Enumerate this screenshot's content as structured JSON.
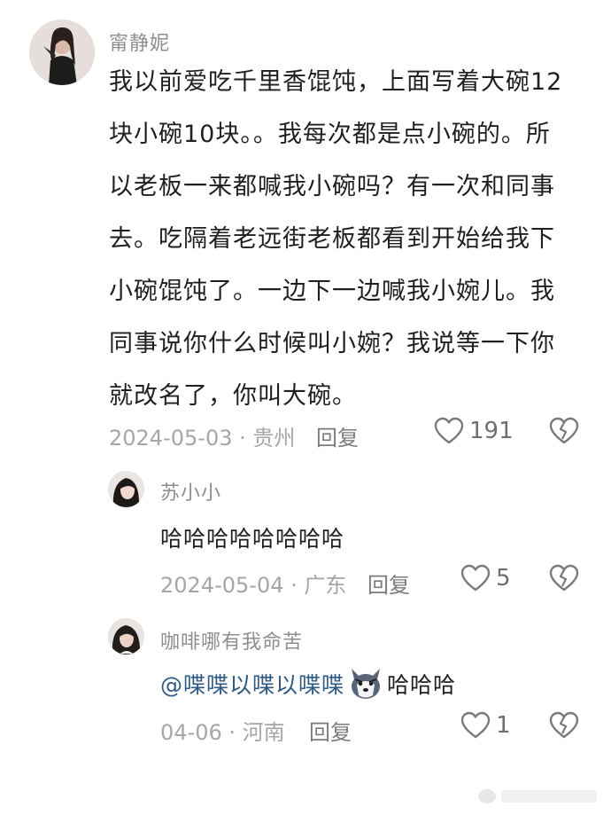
{
  "comments": [
    {
      "username": "甯静妮",
      "text_lines": [
        "我以前爱吃千里香馄饨，上面写着大碗12",
        "块小碗10块。。我每次都是点小碗的。所",
        "以老板一来都喊我小碗吗？有一次和同事",
        "去。吃隔着老远街老板都看到开始给我下",
        "小碗馄饨了。一边下一边喊我小婉儿。我",
        "同事说你什么时候叫小婉？我说等一下你",
        "就改名了，你叫大碗。"
      ],
      "meta": "2024-05-03 · 贵州",
      "reply_label": "回复",
      "likes": "191"
    }
  ],
  "replies": [
    {
      "username": "苏小小",
      "text": "哈哈哈哈哈哈哈哈",
      "meta": "2024-05-04 · 广东",
      "reply_label": "回复",
      "likes": "5"
    },
    {
      "username": "咖啡哪有我命苦",
      "mention": "@喋喋以喋以喋喋",
      "emoji": "husky-emoji",
      "text_after": "哈哈哈",
      "meta": "04-06 · 河南",
      "reply_label": "回复",
      "likes": "1"
    }
  ],
  "colors": {
    "username": "#8e8e8e",
    "body_text": "#1f1f1f",
    "meta": "#a6a6a6",
    "mention": "#2f5a86",
    "icon_stroke": "#7a7a7a"
  }
}
